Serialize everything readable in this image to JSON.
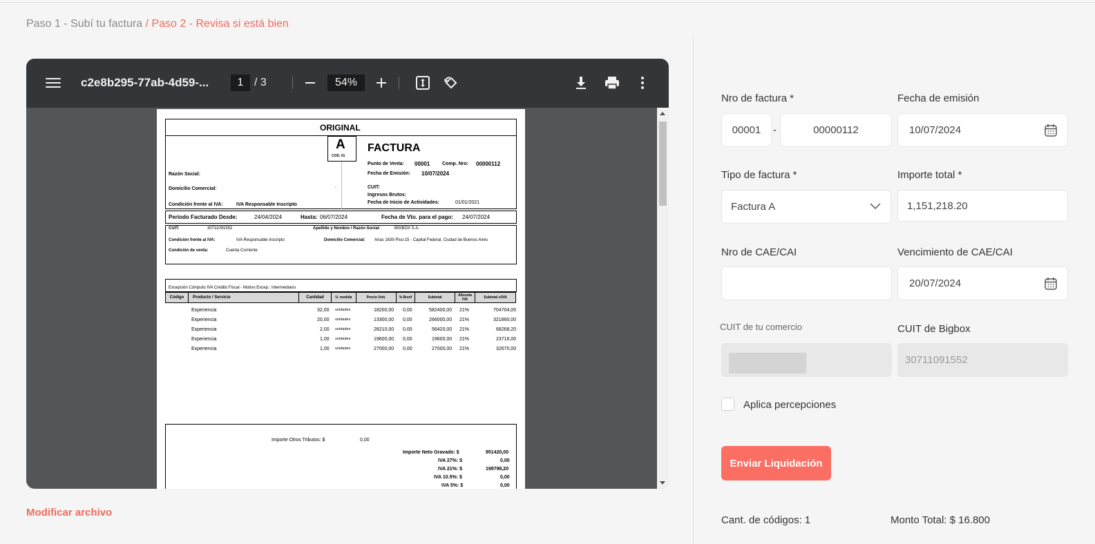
{
  "breadcrumb": {
    "step1": "Paso 1 - Subí tu factura",
    "separator": "/",
    "step2": "Paso 2 - Revisa si está bien"
  },
  "viewer": {
    "filename": "c2e8b295-77ab-4d59-...",
    "current_page": "1",
    "total_pages": "/  3",
    "zoom": "54%",
    "icons": [
      "menu-icon",
      "zoom-out-icon",
      "zoom-in-icon",
      "fit-page-icon",
      "rotate-icon",
      "download-icon",
      "print-icon",
      "more-icon"
    ]
  },
  "invoice": {
    "original": "ORIGINAL",
    "letter": "A",
    "code": "COD. 01",
    "title": "FACTURA",
    "punto_venta_label": "Punto de Venta:",
    "punto_venta": "00001",
    "comp_nro_label": "Comp. Nro:",
    "comp_nro": "00000112",
    "fecha_emision_label": "Fecha de Emisión:",
    "fecha_emision": "10/07/2024",
    "razon_social_label": "Razón Social:",
    "domicilio_label": "Domicilio Comercial:",
    "domicilio_mark": "-",
    "cuit_label": "CUIT:",
    "ingresos_label": "Ingresos Brutos:",
    "inicio_act_label": "Fecha de Inicio de Actividades:",
    "inicio_act": "01/01/2021",
    "cond_iva_label": "Condición frente al IVA:",
    "cond_iva": "IVA Responsable Inscripto",
    "periodo_desde_label": "Período Facturado Desde:",
    "periodo_desde": "24/04/2024",
    "hasta_label": "Hasta:",
    "hasta": "06/07/2024",
    "vto_label": "Fecha de Vto. para el pago:",
    "vto": "24/07/2024",
    "client_cuit_label": "CUIT:",
    "client_cuit": "30711091552",
    "client_name_label": "Apellido y Nombre / Razón Social:",
    "client_name": "BIGBOX S.A.",
    "client_iva_label": "Condición frente al IVA:",
    "client_iva": "IVA Responsable Inscripto",
    "client_dom_label": "Domicilio Comercial:",
    "client_dom": "Arias 1639 Piso:15 - Capital Federal, Ciudad de Buenos Aires",
    "cond_venta_label": "Condición de venta:",
    "cond_venta": "Cuenta Corriente",
    "excepcion": "Excepción Cómputo IVA Crédito Fiscal - Motivo Excep.: Intermediario",
    "columns": [
      "Código",
      "Producto / Servicio",
      "Cantidad",
      "U. medida",
      "Precio Unit.",
      "% Bonif",
      "Subtotal",
      "Alícuota IVA",
      "Subtotal c/IVA"
    ],
    "items": [
      {
        "producto": "Experiencia",
        "cantidad": "32,00",
        "unidad": "unidades",
        "precio": "18200,00",
        "bonif": "0,00",
        "subtotal": "582400,00",
        "alicuota": "21%",
        "subtotal_iva": "704704,00"
      },
      {
        "producto": "Experiencia",
        "cantidad": "20,00",
        "unidad": "unidades",
        "precio": "13300,00",
        "bonif": "0,00",
        "subtotal": "266000,00",
        "alicuota": "21%",
        "subtotal_iva": "321860,00"
      },
      {
        "producto": "Experiencia",
        "cantidad": "2,00",
        "unidad": "unidades",
        "precio": "28210,00",
        "bonif": "0,00",
        "subtotal": "56420,00",
        "alicuota": "21%",
        "subtotal_iva": "68268,20"
      },
      {
        "producto": "Experiencia",
        "cantidad": "1,00",
        "unidad": "unidades",
        "precio": "19600,00",
        "bonif": "0,00",
        "subtotal": "19600,00",
        "alicuota": "21%",
        "subtotal_iva": "23716,00"
      },
      {
        "producto": "Experiencia",
        "cantidad": "1,00",
        "unidad": "unidades",
        "precio": "27000,00",
        "bonif": "0,00",
        "subtotal": "27000,00",
        "alicuota": "21%",
        "subtotal_iva": "32670,00"
      }
    ],
    "otros_tributos_label": "Importe Otros Tributos: $",
    "otros_tributos": "0,00",
    "totals": [
      {
        "label": "Importe Neto Gravado: $",
        "value": "951420,00"
      },
      {
        "label": "IVA 27%: $",
        "value": "0,00"
      },
      {
        "label": "IVA 21%: $",
        "value": "199798,20"
      },
      {
        "label": "IVA 10.5%: $",
        "value": "0,00"
      },
      {
        "label": "IVA 5%: $",
        "value": "0,00"
      }
    ]
  },
  "form": {
    "nro_factura_label": "Nro de factura *",
    "nro_factura_pv": "00001",
    "nro_factura_sep": "-",
    "nro_factura_num": "00000112",
    "fecha_emision_label": "Fecha de emisión",
    "fecha_emision": "10/07/2024",
    "tipo_factura_label": "Tipo de factura *",
    "tipo_factura": "Factura A",
    "importe_label": "Importe total *",
    "importe": "1,151,218.20",
    "cae_label": "Nro de CAE/CAI",
    "cae": "",
    "vto_cae_label": "Vencimiento de CAE/CAI",
    "vto_cae": "20/07/2024",
    "cuit_comercio_label": "CUIT de tu comercio",
    "cuit_bigbox_label": "CUIT de Bigbox",
    "cuit_bigbox": "30711091552",
    "percepciones_label": "Aplica percepciones",
    "submit_label": "Enviar Liquidación",
    "cant_codigos": "Cant. de códigos: 1",
    "monto_total": "Monto Total: $ 16.800"
  },
  "modify_link": "Modificar archivo",
  "colors": {
    "accent": "#fa6e63",
    "toolbar": "#323639",
    "viewer_bg": "#525659"
  }
}
